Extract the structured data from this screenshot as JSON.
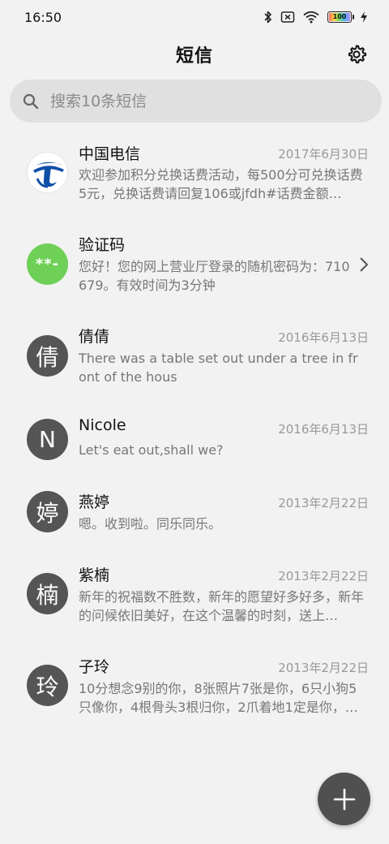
{
  "status_bar": {
    "time": "16:50",
    "battery": "100",
    "icons": [
      "bluetooth-icon",
      "sim-icon",
      "wifi-icon",
      "battery-icon",
      "charging-icon"
    ]
  },
  "header": {
    "title": "短信",
    "settings_icon": "gear-icon"
  },
  "search": {
    "placeholder": "搜索10条短信",
    "icon": "search-icon"
  },
  "messages": [
    {
      "sender": "中国电信",
      "date": "2017年6月30日",
      "preview": "欢迎参加积分兑换话费活动，每500分可兑换话费5元，兑换话费请回复106或jfdh#话费金额…",
      "avatar": "telecom-logo"
    },
    {
      "sender": "验证码",
      "preview": "您好！您的网上营业厅登录的随机密码为：710679。有效时间为3分钟",
      "avatar": "**-"
    },
    {
      "sender": "倩倩",
      "date": "2016年6月13日",
      "preview": "There was a table set out under a tree in front of the hous",
      "avatar": "倩"
    },
    {
      "sender": "Nicole",
      "date": "2016年6月13日",
      "preview": "Let's eat out,shall we?",
      "avatar": "N"
    },
    {
      "sender": "燕婷",
      "date": "2013年2月22日",
      "preview": "嗯。收到啦。同乐同乐。",
      "avatar": "婷"
    },
    {
      "sender": "紫楠",
      "date": "2013年2月22日",
      "preview": "新年的祝福数不胜数，新年的愿望好多好多，新年的问候依旧美好，在这个温馨的时刻，送上…",
      "avatar": "楠"
    },
    {
      "sender": "子玲",
      "date": "2013年2月22日",
      "preview": "10分想念9别的你，8张照片7张是你，6只小狗5只像你，4根骨头3根归你，2爪着地1定是你，…",
      "avatar": "玲"
    }
  ],
  "fab": {
    "icon": "plus-icon"
  },
  "colors": {
    "background": "#f2f2f2",
    "avatar_default": "#555555",
    "avatar_verification": "#6fd058",
    "fab": "#505050",
    "date_text": "#999999",
    "preview_text": "#777777"
  }
}
